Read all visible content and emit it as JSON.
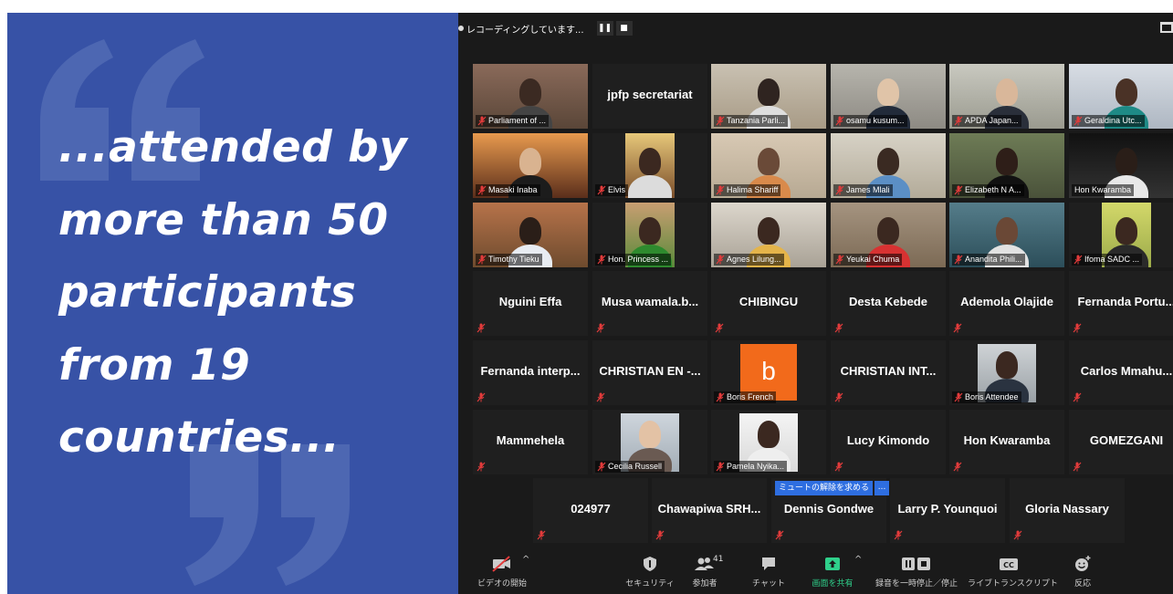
{
  "quote": {
    "lines": [
      "...attended by",
      "more than 50",
      "participants",
      "from 19",
      "countries..."
    ]
  },
  "recording": {
    "text": "レコーディングしています...",
    "pause_icon": "pause-icon",
    "stop_icon": "stop-icon"
  },
  "tiles": [
    {
      "name": "Parliament of ...",
      "type": "video"
    },
    {
      "name": "jpfp secretariat",
      "type": "name"
    },
    {
      "name": "Tanzania Parli...",
      "type": "video"
    },
    {
      "name": "osamu kusum...",
      "type": "video"
    },
    {
      "name": "APDA Japan...",
      "type": "video",
      "active": true
    },
    {
      "name": "Geraldina Utc...",
      "type": "video"
    },
    {
      "name": "Masaki Inaba",
      "type": "video"
    },
    {
      "name": "Elvis",
      "type": "video"
    },
    {
      "name": "Halima Shariff",
      "type": "video"
    },
    {
      "name": "James Mlali",
      "type": "video"
    },
    {
      "name": "Elizabeth N A...",
      "type": "video"
    },
    {
      "name": "Hon Kwaramba",
      "type": "video"
    },
    {
      "name": "Timothy Tieku",
      "type": "video"
    },
    {
      "name": "Hon. Princess ...",
      "type": "video"
    },
    {
      "name": "Agnes Lilung...",
      "type": "video"
    },
    {
      "name": "Yeukai Chuma",
      "type": "video"
    },
    {
      "name": "Anandita Phili...",
      "type": "video"
    },
    {
      "name": "Ifoma SADC ...",
      "type": "video"
    },
    {
      "name": "Nguini Effa",
      "type": "name"
    },
    {
      "name": "Musa wamala.b...",
      "type": "name"
    },
    {
      "name": "CHIBINGU",
      "type": "name"
    },
    {
      "name": "Desta Kebede",
      "type": "name"
    },
    {
      "name": "Ademola Olajide",
      "type": "name"
    },
    {
      "name": "Fernanda Portu...",
      "type": "name"
    },
    {
      "name": "Fernanda interp...",
      "type": "name"
    },
    {
      "name": "CHRISTIAN EN -...",
      "type": "name"
    },
    {
      "name": "Boris French",
      "type": "avatar",
      "avatar_letter": "b"
    },
    {
      "name": "CHRISTIAN INT...",
      "type": "name"
    },
    {
      "name": "Boris Attendee",
      "type": "photo"
    },
    {
      "name": "Carlos Mmahu...",
      "type": "name"
    },
    {
      "name": "Mammehela",
      "type": "name"
    },
    {
      "name": "Cecilia Russell",
      "type": "photo"
    },
    {
      "name": "Pamela Nyika...",
      "type": "photo"
    },
    {
      "name": "Lucy Kimondo",
      "type": "name"
    },
    {
      "name": "Hon Kwaramba",
      "type": "name"
    },
    {
      "name": "GOMEZGANI",
      "type": "name"
    },
    {
      "name": "024977",
      "type": "name"
    },
    {
      "name": "Chawapiwa SRH...",
      "type": "name"
    },
    {
      "name": "Dennis Gondwe",
      "type": "name"
    },
    {
      "name": "Larry P. Younquoi",
      "type": "name"
    },
    {
      "name": "Gloria Nassary",
      "type": "name"
    }
  ],
  "unmute_request": {
    "label": "ミュートの解除を求める",
    "more": "..."
  },
  "toolbar": {
    "video": "ビデオの開始",
    "security": "セキュリティ",
    "participants": "参加者",
    "participant_count": "41",
    "chat": "チャット",
    "share": "画面を共有",
    "record": "録音を一時停止／停止",
    "transcript": "ライブトランスクリプト",
    "reactions": "反応",
    "transcript_badge": "CC"
  },
  "colors": {
    "quote_panel": "#3752a6",
    "active_speaker": "#c3d94e",
    "share_green": "#2fd08b",
    "mute_red": "#e23b3b",
    "avatar_orange": "#f26a1b"
  }
}
